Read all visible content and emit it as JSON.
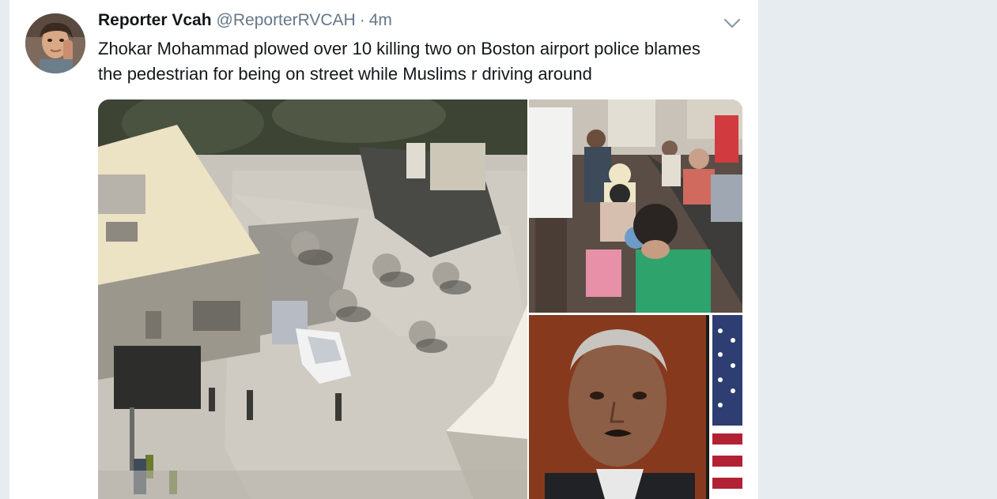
{
  "tweet": {
    "display_name": "Reporter Vcah",
    "handle": "@ReporterRVCAH",
    "separator": "·",
    "time": "4m",
    "text_line1": "Zhokar Mohammad plowed over 10 killing two on Boston airport police blames",
    "text_line2": "the pedestrian for being on street while Muslims r driving around",
    "caret_icon": "chevron-down-icon",
    "media_count": 3
  },
  "colors": {
    "page_background": "#e6ecf0",
    "card_background": "#ffffff",
    "name_text": "#14171a",
    "meta_text": "#657786",
    "caret": "#8899a6"
  }
}
